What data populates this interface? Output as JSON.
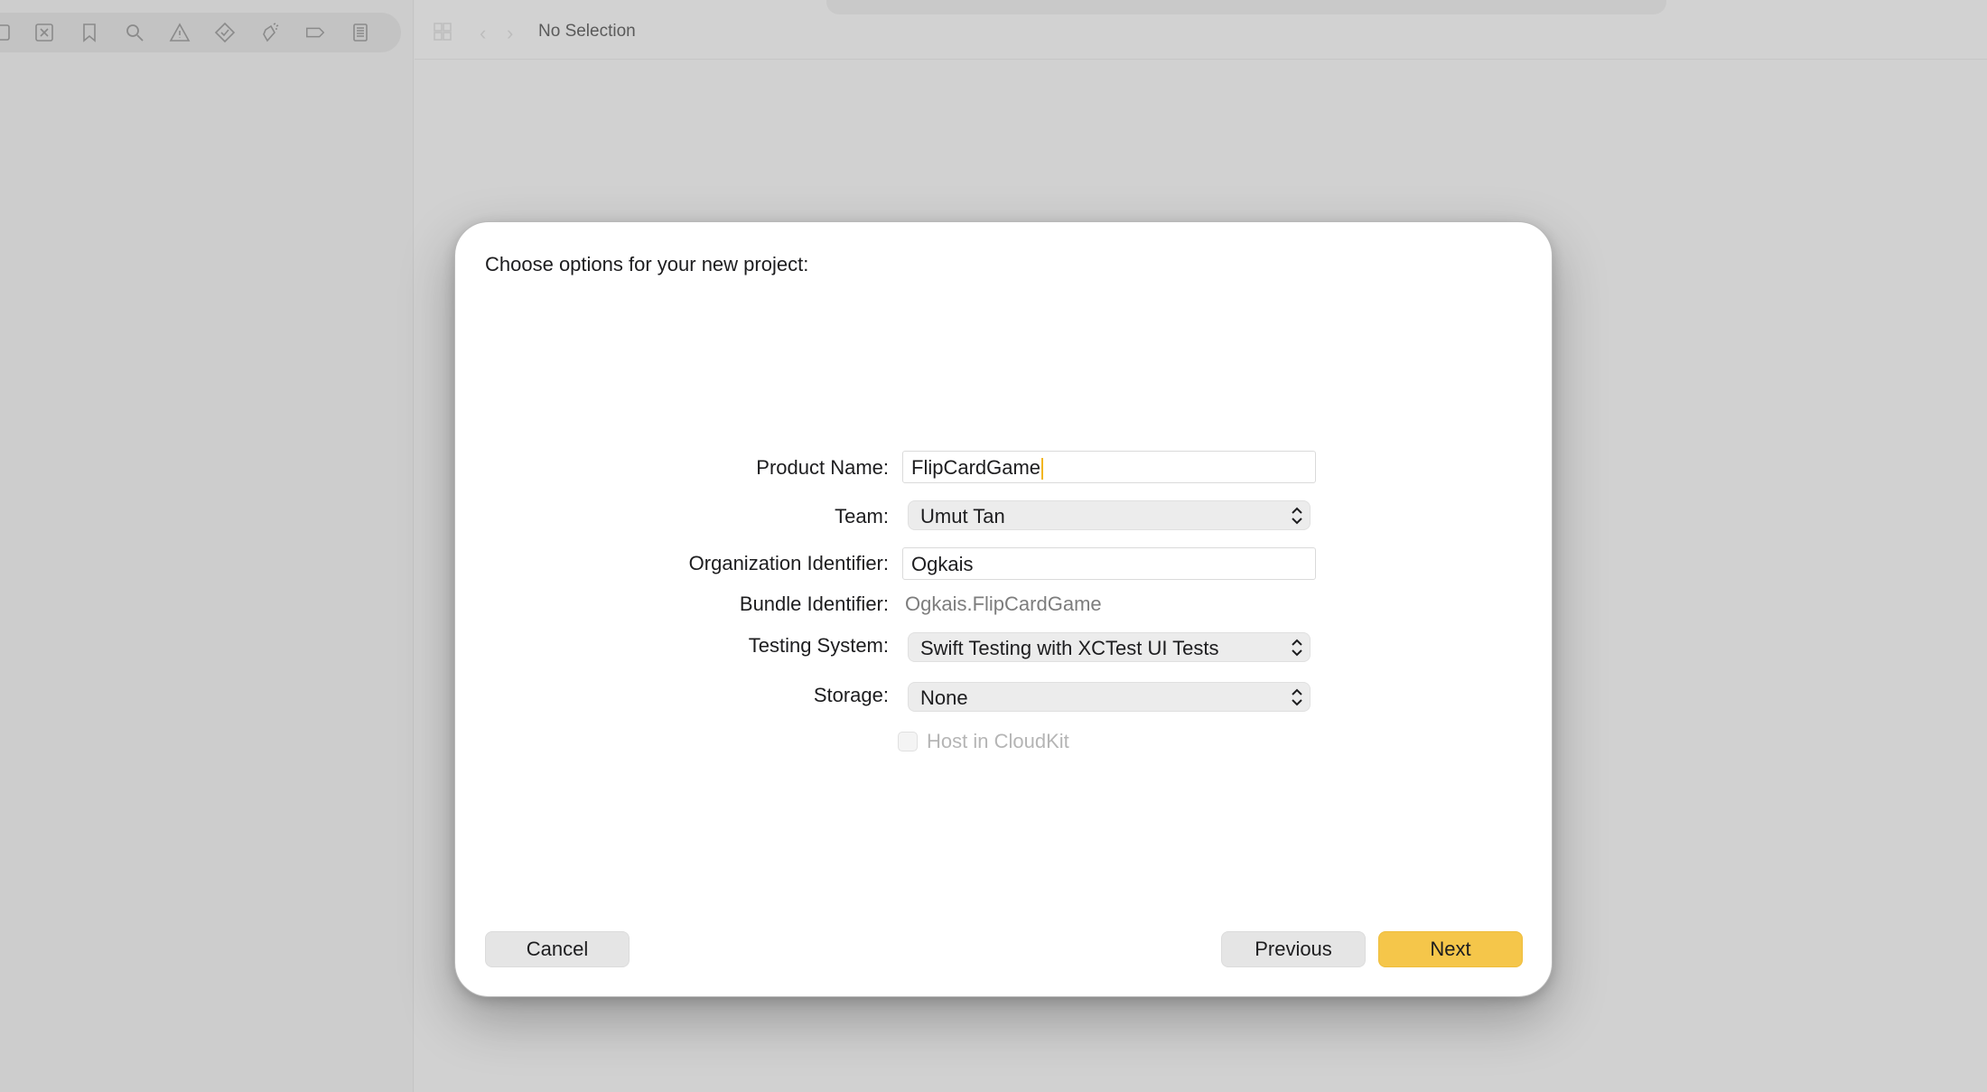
{
  "background": {
    "navigator_icons": [
      "sidebar-icon",
      "close-square-icon",
      "bookmark-icon",
      "search-icon",
      "warning-icon",
      "diamond-check-icon",
      "spray-icon",
      "tag-icon",
      "report-icon"
    ],
    "editor_status": "No Selection"
  },
  "dialog": {
    "title": "Choose options for your new project:",
    "fields": {
      "product_name": {
        "label": "Product Name:",
        "value": "FlipCardGame"
      },
      "team": {
        "label": "Team:",
        "value": "Umut Tan"
      },
      "org_identifier": {
        "label": "Organization Identifier:",
        "value": "Ogkais"
      },
      "bundle_identifier": {
        "label": "Bundle Identifier:",
        "value": "Ogkais.FlipCardGame"
      },
      "testing_system": {
        "label": "Testing System:",
        "value": "Swift Testing with XCTest UI Tests"
      },
      "storage": {
        "label": "Storage:",
        "value": "None"
      },
      "host_in_cloudkit": {
        "label": "Host in CloudKit",
        "checked": false,
        "enabled": false
      }
    },
    "buttons": {
      "cancel": "Cancel",
      "previous": "Previous",
      "next": "Next"
    },
    "accent_color": "#f5c64a"
  }
}
